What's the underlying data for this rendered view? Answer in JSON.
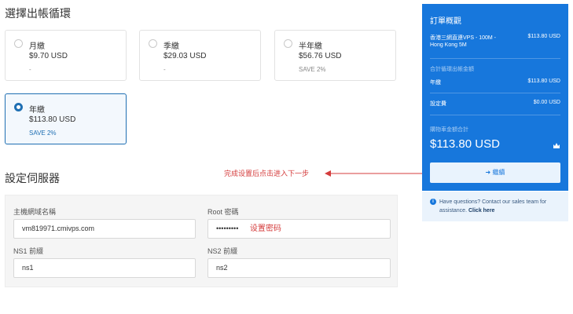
{
  "billing": {
    "title": "選擇出帳循環",
    "cycles": [
      {
        "name": "月繳",
        "price": "$9.70 USD",
        "note": "-",
        "selected": false
      },
      {
        "name": "季繳",
        "price": "$29.03 USD",
        "note": "-",
        "selected": false
      },
      {
        "name": "半年繳",
        "price": "$56.76 USD",
        "note": "SAVE 2%",
        "selected": false
      },
      {
        "name": "年繳",
        "price": "$113.80 USD",
        "note": "SAVE 2%",
        "selected": true
      }
    ]
  },
  "server": {
    "title": "設定伺服器",
    "annotation": "完成设置后点击进入下一步",
    "hostname_label": "主機網域名稱",
    "hostname_value": "vm819971.cmivps.com",
    "root_label": "Root 密碼",
    "root_value": "•••••••••",
    "root_annotation": "设置密码",
    "ns1_label": "NS1 前綴",
    "ns1_value": "ns1",
    "ns2_label": "NS2 前綴",
    "ns2_value": "ns2"
  },
  "summary": {
    "title": "訂單概觀",
    "product_name_line1": "香港三網直連VPS - 100M -",
    "product_name_line2": "Hong Kong 5M",
    "product_price": "$113.80 USD",
    "recurring_label": "合計循環出帳金額",
    "cycle_label": "年繳",
    "cycle_price": "$113.80 USD",
    "setup_label": "設定費",
    "setup_price": "$0.00 USD",
    "total_label": "購物車金額合計",
    "total": "$113.80 USD",
    "continue_label": "繼續"
  },
  "help": {
    "text": "Have questions? Contact our sales team for assistance.",
    "link": "Click here"
  },
  "colors": {
    "accent": "#1777dc",
    "annotation": "#d43c3c"
  }
}
